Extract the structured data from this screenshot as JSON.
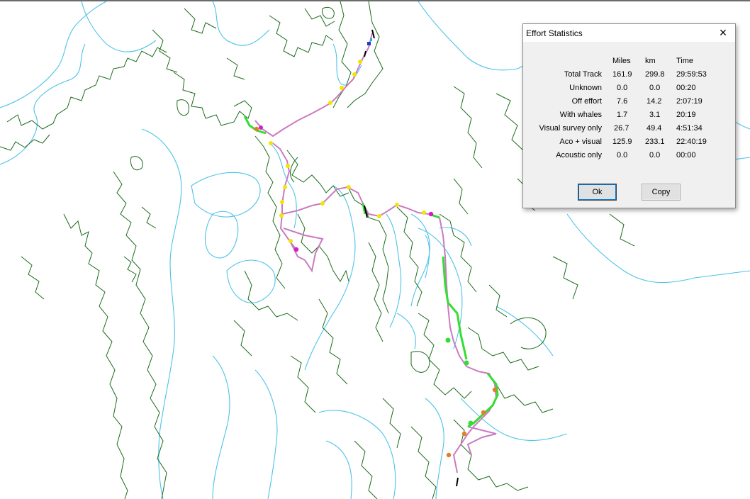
{
  "dialog": {
    "title": "Effort Statistics",
    "close_glyph": "×",
    "column_headers": [
      "Miles",
      "km",
      "Time"
    ],
    "rows": [
      {
        "label": "Total Track",
        "miles": "161.9",
        "km": "299.8",
        "time": "29:59:53"
      },
      {
        "label": "Unknown",
        "miles": "0.0",
        "km": "0.0",
        "time": "00:20"
      },
      {
        "label": "Off effort",
        "miles": "7.6",
        "km": "14.2",
        "time": "2:07:19"
      },
      {
        "label": "With whales",
        "miles": "1.7",
        "km": "3.1",
        "time": "20:19"
      },
      {
        "label": "Visual survey only",
        "miles": "26.7",
        "km": "49.4",
        "time": "4:51:34"
      },
      {
        "label": "Aco + visual",
        "miles": "125.9",
        "km": "233.1",
        "time": "22:40:19"
      },
      {
        "label": "Acoustic only",
        "miles": "0.0",
        "km": "0.0",
        "time": "00:00"
      }
    ],
    "ok_label": "Ok",
    "copy_label": "Copy"
  },
  "colors": {
    "coastline": "#1a6b1a",
    "depth_contour": "#4cc3e8",
    "track_off_effort": "#cc7ac0",
    "track_visual": "#33dd33",
    "marker_yellow": "#f2e600",
    "marker_orange": "#e08020",
    "marker_magenta": "#cc22cc"
  }
}
